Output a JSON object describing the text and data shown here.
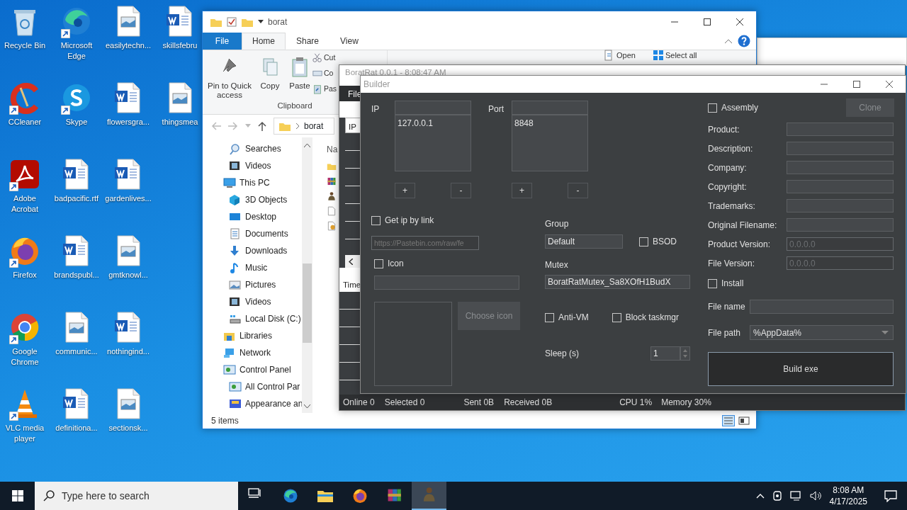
{
  "desktop_icons": [
    {
      "label": "Recycle Bin",
      "kind": "recycle",
      "shortcut": false
    },
    {
      "label": "CCleaner",
      "kind": "ccleaner",
      "shortcut": true
    },
    {
      "label": "Adobe Acrobat",
      "kind": "acrobat",
      "shortcut": true
    },
    {
      "label": "Firefox",
      "kind": "firefox",
      "shortcut": true
    },
    {
      "label": "Google Chrome",
      "kind": "chrome",
      "shortcut": true
    },
    {
      "label": "VLC media player",
      "kind": "vlc",
      "shortcut": true
    },
    {
      "label": "Microsoft Edge",
      "kind": "edge",
      "shortcut": true
    },
    {
      "label": "Skype",
      "kind": "skype",
      "shortcut": true
    },
    {
      "label": "badpacific.rtf",
      "kind": "word",
      "shortcut": false
    },
    {
      "label": "brandspubl...",
      "kind": "word",
      "shortcut": false
    },
    {
      "label": "communic...",
      "kind": "image",
      "shortcut": false
    },
    {
      "label": "definitiona...",
      "kind": "word",
      "shortcut": false
    },
    {
      "label": "easilytechn...",
      "kind": "image",
      "shortcut": false
    },
    {
      "label": "flowersgra...",
      "kind": "word",
      "shortcut": false
    },
    {
      "label": "gardenlives...",
      "kind": "word",
      "shortcut": false
    },
    {
      "label": "gmtknowl...",
      "kind": "image",
      "shortcut": false
    },
    {
      "label": "nothingind...",
      "kind": "word",
      "shortcut": false
    },
    {
      "label": "sectionsk...",
      "kind": "image",
      "shortcut": false
    },
    {
      "label": "skillsfebru",
      "kind": "word",
      "shortcut": false
    },
    {
      "label": "thingsmea",
      "kind": "image",
      "shortcut": false
    }
  ],
  "explorer": {
    "title": "borat",
    "ribbon_tabs": [
      {
        "label": "File",
        "kind": "file",
        "selected": false
      },
      {
        "label": "Home",
        "kind": "tab",
        "selected": true
      },
      {
        "label": "Share",
        "kind": "tab",
        "selected": false
      },
      {
        "label": "View",
        "kind": "tab",
        "selected": false
      }
    ],
    "large_commands": [
      {
        "label": "Pin to Quick access",
        "kind": "pin"
      },
      {
        "label": "Copy",
        "kind": "copy"
      },
      {
        "label": "Paste",
        "kind": "paste"
      }
    ],
    "small_commands": [
      {
        "label": "Cut",
        "kind": "cut"
      },
      {
        "label": "Co",
        "kind": "copypath"
      },
      {
        "label": "Pas",
        "kind": "pasteshortcut"
      }
    ],
    "group_label": "Clipboard",
    "right_commands": [
      {
        "label": "Open",
        "kind": "open"
      },
      {
        "label": "Select all",
        "kind": "selectall"
      }
    ],
    "address": "borat",
    "nav_continued": [
      {
        "label": "Searches",
        "kind": "search"
      },
      {
        "label": "Videos",
        "kind": "video"
      }
    ],
    "nav_tree": [
      {
        "label": "This PC",
        "kind": "pc",
        "children": [
          {
            "label": "3D Objects",
            "kind": "cube"
          },
          {
            "label": "Desktop",
            "kind": "desktop"
          },
          {
            "label": "Documents",
            "kind": "docs"
          },
          {
            "label": "Downloads",
            "kind": "download"
          },
          {
            "label": "Music",
            "kind": "music"
          },
          {
            "label": "Pictures",
            "kind": "pictures"
          },
          {
            "label": "Videos",
            "kind": "video"
          },
          {
            "label": "Local Disk (C:)",
            "kind": "disk"
          }
        ]
      },
      {
        "label": "Libraries",
        "kind": "libraries"
      },
      {
        "label": "Network",
        "kind": "network"
      },
      {
        "label": "Control Panel",
        "kind": "control",
        "children": [
          {
            "label": "All Control Par",
            "kind": "control"
          },
          {
            "label": "Appearance an",
            "kind": "appearance"
          }
        ]
      }
    ],
    "column_header": "Na",
    "files": [
      {
        "kind": "folder"
      },
      {
        "kind": "archive"
      },
      {
        "kind": "figure"
      },
      {
        "kind": "blank"
      },
      {
        "kind": "config"
      }
    ],
    "status": "5 items"
  },
  "rat_window": {
    "title": "BoratRat 0.0.1 - 8:08:47 AM",
    "menu": "File",
    "table_header": "IP",
    "log_header": "Time",
    "status": [
      {
        "label": "Online 0"
      },
      {
        "label": "Selected 0"
      },
      {
        "label": "Sent 0B"
      },
      {
        "label": "Received 0B"
      },
      {
        "label": "CPU 1%"
      },
      {
        "label": "Memory 30%"
      }
    ]
  },
  "builder": {
    "title": "Builder",
    "ip": {
      "label": "IP",
      "entries": [
        "127.0.0.1"
      ],
      "add": "+",
      "remove": "-"
    },
    "port": {
      "label": "Port",
      "entries": [
        "8848"
      ],
      "add": "+",
      "remove": "-"
    },
    "get_ip_by_link": {
      "label": "Get ip by link",
      "checked": false,
      "placeholder": "https://Pastebin.com/raw/fe"
    },
    "icon": {
      "label": "Icon",
      "checked": false
    },
    "choose_icon": {
      "label": "Choose icon",
      "disabled": true
    },
    "group": {
      "label": "Group",
      "value": "Default"
    },
    "bsod": {
      "label": "BSOD",
      "checked": false
    },
    "mutex": {
      "label": "Mutex",
      "value": "BoratRatMutex_Sa8XOfH1BudX"
    },
    "anti_vm": {
      "label": "Anti-VM",
      "checked": false
    },
    "block_taskmgr": {
      "label": "Block taskmgr",
      "checked": false
    },
    "sleep": {
      "label": "Sleep (s)",
      "value": "1"
    },
    "assembly": {
      "label": "Assembly",
      "checked": false
    },
    "clone": {
      "label": "Clone",
      "disabled": true
    },
    "assembly_fields": [
      {
        "label": "Product:",
        "disabled": false
      },
      {
        "label": "Description:",
        "disabled": false
      },
      {
        "label": "Company:",
        "disabled": false
      },
      {
        "label": "Copyright:",
        "disabled": false
      },
      {
        "label": "Trademarks:",
        "disabled": false
      },
      {
        "label": "Original Filename:",
        "disabled": false
      },
      {
        "label": "Product Version:",
        "value": "0.0.0.0",
        "disabled": true
      },
      {
        "label": "File Version:",
        "value": "0.0.0.0",
        "disabled": true
      }
    ],
    "install": {
      "label": "Install",
      "checked": false
    },
    "file_name": {
      "label": "File name"
    },
    "file_path": {
      "label": "File path",
      "value": "%AppData%"
    },
    "build": "Build exe"
  },
  "taskbar": {
    "search_placeholder": "Type here to search",
    "apps": [
      {
        "kind": "taskview",
        "selected": false
      },
      {
        "kind": "edge",
        "selected": false
      },
      {
        "kind": "folder",
        "selected": false
      },
      {
        "kind": "firefox",
        "selected": false
      },
      {
        "kind": "archive",
        "selected": false
      },
      {
        "kind": "figure",
        "selected": true
      }
    ],
    "time": "8:08 AM",
    "date": "4/17/2025"
  }
}
